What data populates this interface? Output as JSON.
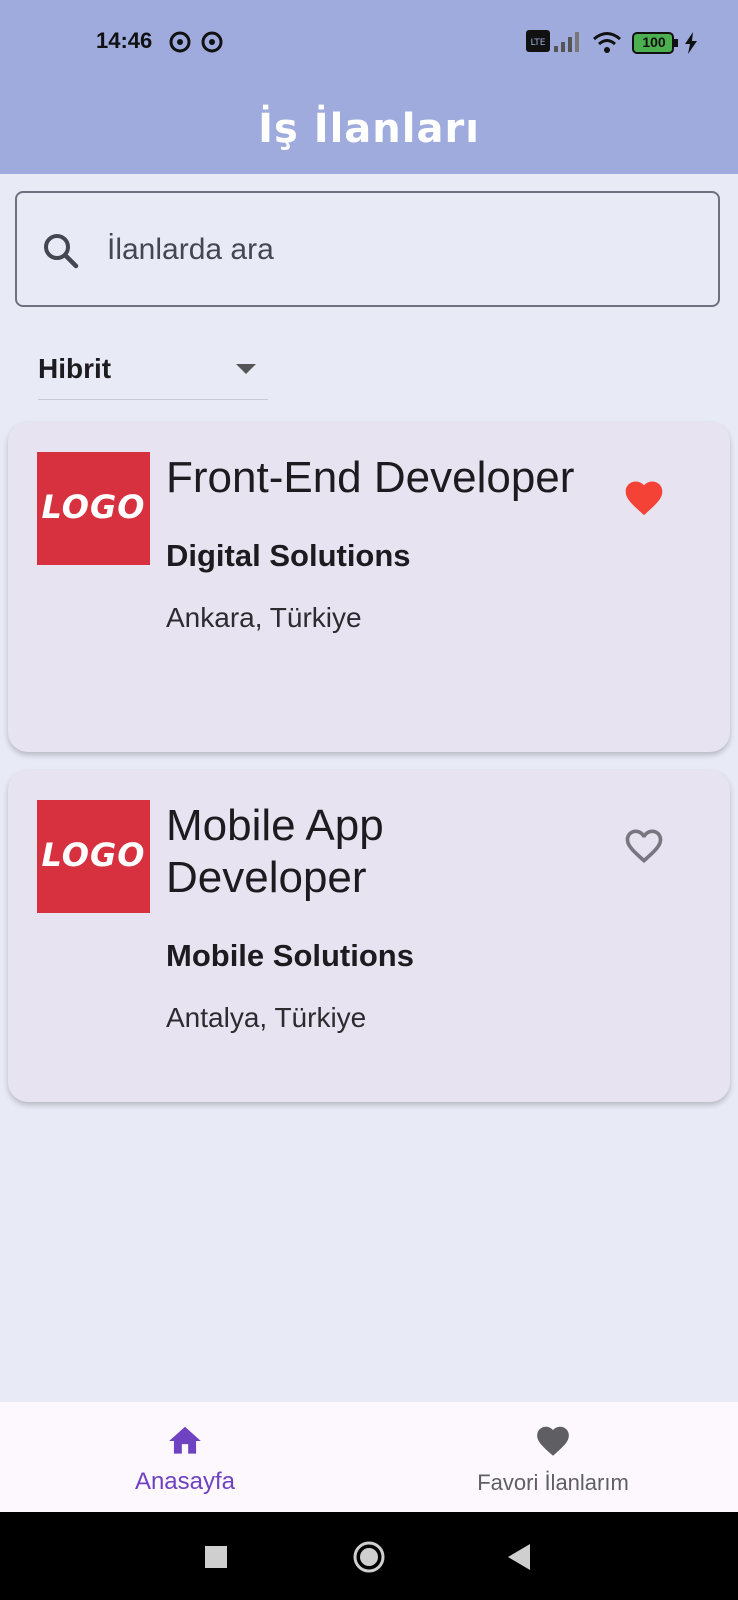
{
  "status_bar": {
    "time": "14:46",
    "battery": "100"
  },
  "app_bar": {
    "title": "İş İlanları"
  },
  "search": {
    "placeholder": "İlanlarda ara",
    "value": ""
  },
  "filter": {
    "selected": "Hibrit"
  },
  "jobs": [
    {
      "logo_text": "LOGO",
      "title": "Front-End Developer",
      "company": "Digital Solutions",
      "location": "Ankara, Türkiye",
      "favorite": true
    },
    {
      "logo_text": "LOGO",
      "title": "Mobile App Developer",
      "company": "Mobile Solutions",
      "location": "Antalya, Türkiye",
      "favorite": false
    }
  ],
  "bottom_nav": {
    "items": [
      {
        "label": "Anasayfa",
        "icon": "home-icon",
        "active": true
      },
      {
        "label": "Favori İlanlarım",
        "icon": "heart-icon",
        "active": false
      }
    ]
  },
  "colors": {
    "app_bar": "#9fabdd",
    "background": "#e8ebf6",
    "card": "#e8e3f0",
    "logo_bg": "#d7303f",
    "favorite": "#f44336",
    "nav_active": "#6f42c1",
    "nav_inactive": "#5f5f63"
  }
}
